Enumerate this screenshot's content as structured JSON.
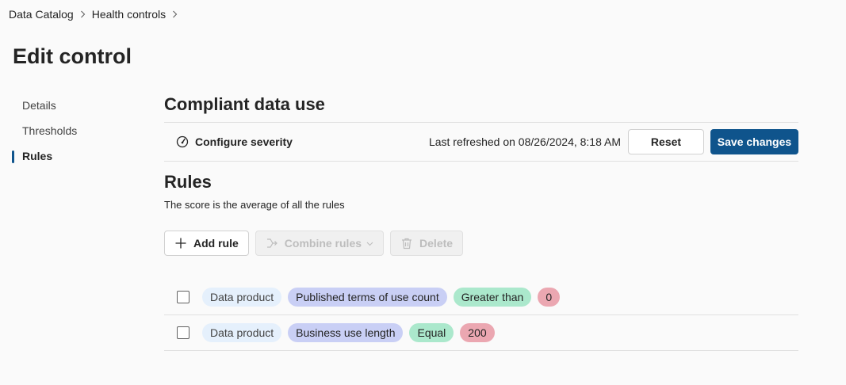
{
  "breadcrumb": {
    "items": [
      "Data Catalog",
      "Health controls"
    ]
  },
  "page": {
    "title": "Edit control"
  },
  "side_nav": {
    "items": [
      {
        "label": "Details",
        "active": false
      },
      {
        "label": "Thresholds",
        "active": false
      },
      {
        "label": "Rules",
        "active": true
      }
    ]
  },
  "section": {
    "title": "Compliant data use"
  },
  "toolbar": {
    "configure_label": "Configure severity",
    "refreshed_text": "Last refreshed on 08/26/2024, 8:18 AM",
    "reset_label": "Reset",
    "save_label": "Save changes"
  },
  "rules": {
    "title": "Rules",
    "subtitle": "The score is the average of all the rules",
    "actions": {
      "add_label": "Add rule",
      "combine_label": "Combine rules",
      "delete_label": "Delete"
    },
    "rows": [
      {
        "object": "Data product",
        "field": "Published terms of use count",
        "operator": "Greater than",
        "value": "0"
      },
      {
        "object": "Data product",
        "field": "Business use length",
        "operator": "Equal",
        "value": "200"
      }
    ]
  },
  "colors": {
    "accent": "#0f548c",
    "pill_object": "#e5f0fc",
    "pill_field": "#c9cff5",
    "pill_operator": "#abe8cc",
    "pill_value": "#eba7b1"
  },
  "icons": {
    "breadcrumb_separator": "chevron-right-icon",
    "configure": "gauge-icon",
    "add": "plus-icon",
    "combine": "merge-icon",
    "delete": "trash-icon"
  }
}
